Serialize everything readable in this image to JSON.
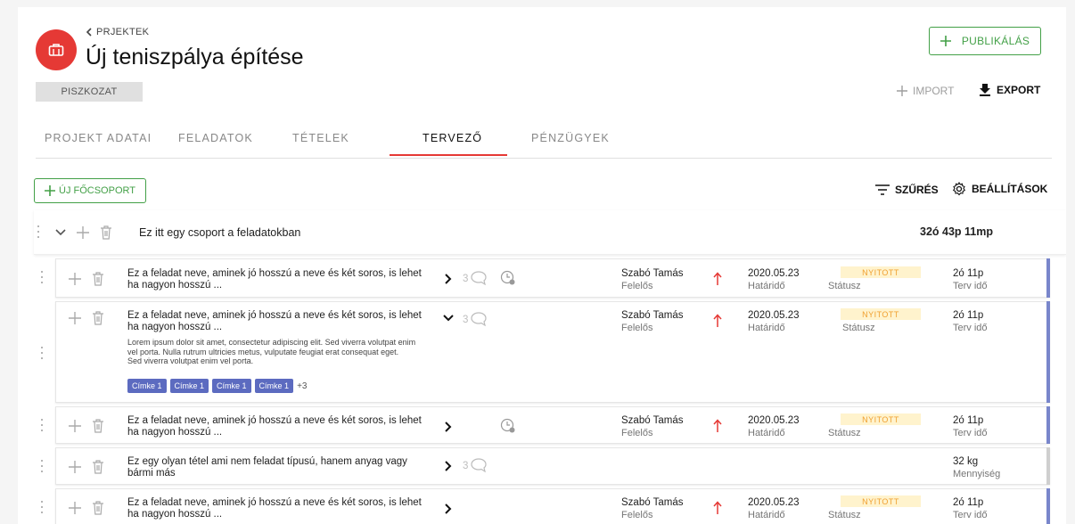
{
  "header": {
    "back_label": "PRJEKTEK",
    "title": "Új teniszpálya építése",
    "status_chip": "PISZKOZAT",
    "publish_label": "PUBLIKÁLÁS",
    "import_label": "IMPORT",
    "export_label": "EXPORT"
  },
  "tabs": [
    {
      "label": "PROJEKT ADATAI"
    },
    {
      "label": "FELADATOK"
    },
    {
      "label": "TÉTELEK"
    },
    {
      "label": "TERVEZŐ"
    },
    {
      "label": "PÉNZÜGYEK"
    }
  ],
  "active_tab": "TERVEZŐ",
  "toolbar": {
    "new_group_label": "ÚJ FŐCSOPORT",
    "filter_label": "SZŰRÉS",
    "settings_label": "BEÁLLÍTÁSOK"
  },
  "group": {
    "title": "Ez itt egy csoport a feladatokban",
    "total_time": "32ó 43p 11mp"
  },
  "rows": [
    {
      "line1": "Ez a feladat neve, aminek jó hosszú a neve és két soros, is lehet",
      "line2": "ha nagyon hosszú ...",
      "comments": "3",
      "assignee": "Szabó Tamás",
      "assignee_label": "Felelős",
      "date": "2020.05.23",
      "date_label": "Határidő",
      "status": "NYITOTT",
      "status_label": "Státusz",
      "time": "2ó 11p",
      "time_label": "Terv idő"
    },
    {
      "line1": "Ez a feladat neve, aminek jó hosszú a neve és két soros, is lehet",
      "line2": "ha nagyon hosszú ...",
      "description_lines": [
        "Lorem ipsum dolor sit amet, consectetur adipiscing elit. Sed viverra volutpat enim",
        "vel porta. Nulla rutrum ultricies metus, vulputate feugiat erat consequat eget.",
        "Sed viverra volutpat enim vel porta."
      ],
      "tags": [
        "Címke 1",
        "Címke 1",
        "Címke 1",
        "Címke 1"
      ],
      "more_tags": "+3",
      "comments": "3",
      "assignee": "Szabó Tamás",
      "assignee_label": "Felelős",
      "date": "2020.05.23",
      "date_label": "Határidő",
      "status": "NYITOTT",
      "status_label": "Státusz",
      "time": "2ó 11p",
      "time_label": "Terv idő"
    },
    {
      "line1": "Ez a feladat neve, aminek jó hosszú a neve és két soros, is lehet",
      "line2": "ha nagyon hosszú ...",
      "assignee": "Szabó Tamás",
      "assignee_label": "Felelős",
      "date": "2020.05.23",
      "date_label": "Határidő",
      "status": "NYITOTT",
      "status_label": "Státusz",
      "time": "2ó 11p",
      "time_label": "Terv idő"
    },
    {
      "line1": "Ez egy olyan tétel ami nem feladat típusú, hanem anyag vagy",
      "line2": "bármi más",
      "comments": "3",
      "quantity": "32 kg",
      "quantity_label": "Mennyiség"
    },
    {
      "line1": "Ez a feladat neve, aminek jó hosszú a neve és két soros, is lehet",
      "line2": "ha nagyon hosszú ...",
      "assignee": "Szabó Tamás",
      "assignee_label": "Felelős",
      "date": "2020.05.23",
      "date_label": "Határidő",
      "status": "NYITOTT",
      "status_label": "Státusz",
      "time": "2ó 11p",
      "time_label": "Terv idő"
    }
  ],
  "colors": {
    "accent_red": "#e53935",
    "accent_green": "#43a047",
    "task_bar": "#7986cb",
    "item_bar": "#cfcfcf",
    "status_bg": "#fff3cd",
    "status_text": "#f0a030",
    "tag_bg": "#5c6bc0"
  },
  "icons": [
    "briefcase-icon",
    "chevron-left-icon",
    "plus-icon",
    "download-icon",
    "filter-icon",
    "gear-icon",
    "drag-handle-icon",
    "chevron-down-icon",
    "trash-icon",
    "chevron-right-icon",
    "comment-icon",
    "clock-icon",
    "arrow-up-icon"
  ]
}
